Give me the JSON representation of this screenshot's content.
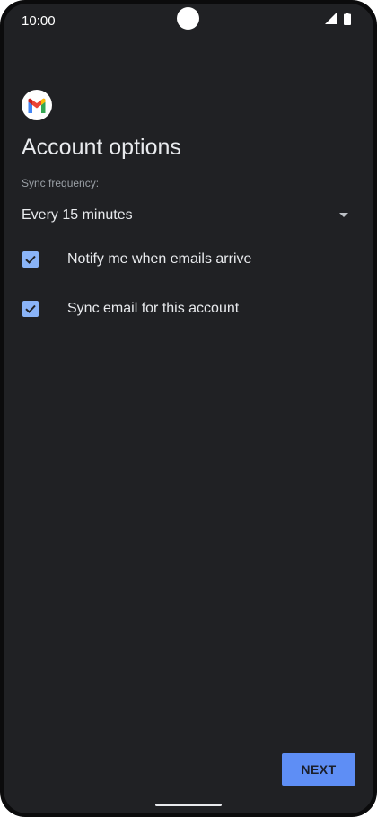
{
  "status_bar": {
    "time": "10:00",
    "icons": [
      "signal-icon",
      "battery-icon"
    ]
  },
  "app": {
    "logo_icon": "gmail-logo-icon",
    "title": "Account options"
  },
  "sync": {
    "label": "Sync frequency:",
    "selected_value": "Every 15 minutes"
  },
  "options": [
    {
      "label": "Notify me when emails arrive",
      "checked": true
    },
    {
      "label": "Sync email for this account",
      "checked": true
    }
  ],
  "actions": {
    "next_label": "NEXT"
  },
  "colors": {
    "background": "#202124",
    "accent": "#8ab4f8",
    "button": "#5e8ef5"
  }
}
